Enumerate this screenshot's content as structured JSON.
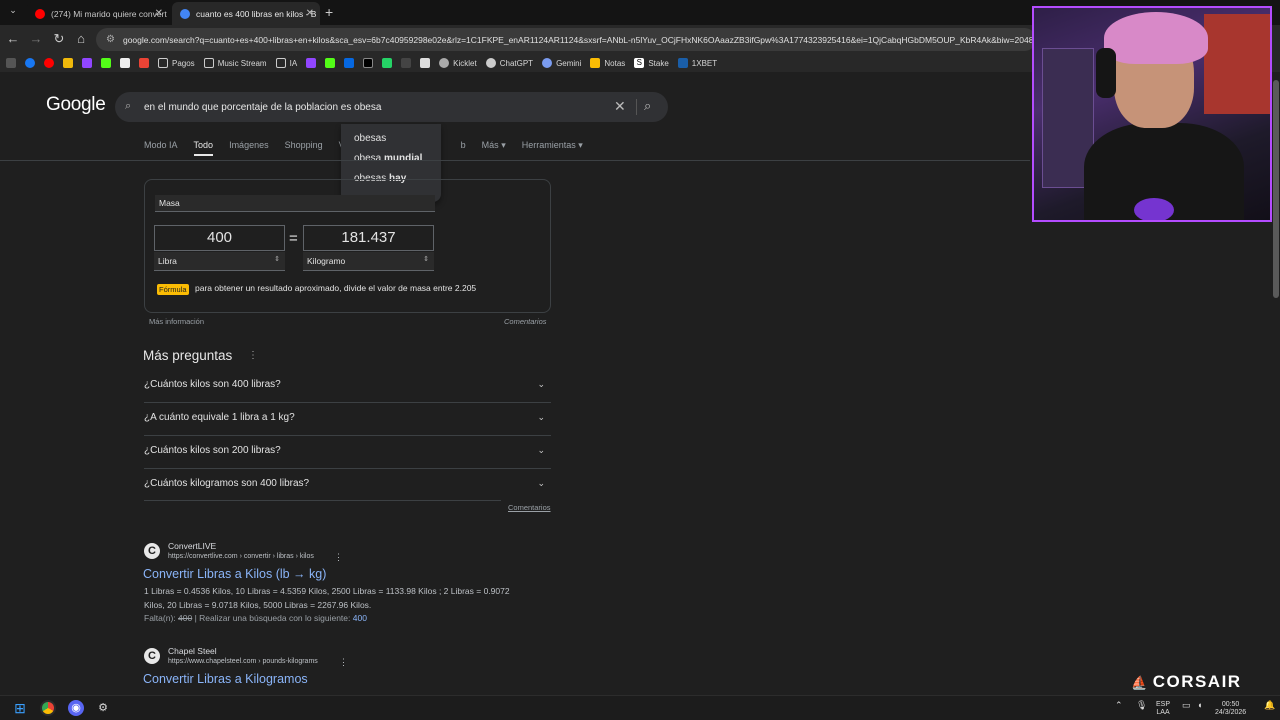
{
  "browser": {
    "tabs": [
      {
        "title": "(274) Mi marido quiere convert",
        "favicon_color": "#ff0000",
        "active": false
      },
      {
        "title": "cuanto es 400 libras en kilos - B",
        "favicon_color": "#4285f4",
        "active": true
      }
    ],
    "url": "google.com/search?q=cuanto+es+400+libras+en+kilos&sca_esv=6b7c40959298e02e&rlz=1C1FKPE_enAR1124AR1124&sxsrf=ANbL-n5lYuv_OCjFHxNK6OAaazZB3ifGpw%3A1774323925416&ei=1QjCabqHGbDM5OUP_KbR4Ak&biw=2048",
    "bookmarks": [
      {
        "label": "Pagos",
        "icon": "folder-icon"
      },
      {
        "label": "Music Stream",
        "icon": "folder-icon"
      },
      {
        "label": "IA",
        "icon": "folder-icon"
      },
      {
        "label": "Kicklet",
        "icon": "kicklet-icon"
      },
      {
        "label": "ChatGPT",
        "icon": "chatgpt-icon"
      },
      {
        "label": "Gemini",
        "icon": "gemini-icon"
      },
      {
        "label": "Notas",
        "icon": "notes-icon"
      },
      {
        "label": "Stake",
        "icon": "stake-icon"
      },
      {
        "label": "1XBET",
        "icon": "1xbet-icon"
      }
    ]
  },
  "google": {
    "logo": "Google",
    "query": "en el mundo que porcentaje de la poblacion es obesa",
    "suggestions": [
      {
        "prefix": "obesas",
        "bold": ""
      },
      {
        "prefix": "obesa ",
        "bold": "mundial"
      },
      {
        "prefix": "obesas ",
        "bold": "hay"
      }
    ],
    "tabs": [
      "Modo IA",
      "Todo",
      "Imágenes",
      "Shopping",
      "V",
      "b",
      "Más",
      "Herramientas"
    ],
    "active_tab": "Todo"
  },
  "converter": {
    "category": "Masa",
    "from_value": "400",
    "to_value": "181.437",
    "equals": "=",
    "from_unit": "Libra",
    "to_unit": "Kilogramo",
    "formula_badge": "Fórmula",
    "formula_text": "para obtener un resultado aproximado, divide el valor de masa entre 2.205",
    "more_info": "Más información",
    "feedback": "Comentarios"
  },
  "paa": {
    "title": "Más preguntas",
    "questions": [
      "¿Cuántos kilos son 400 libras?",
      "¿A cuánto equivale 1 libra a 1 kg?",
      "¿Cuántos kilos son 200 libras?",
      "¿Cuántos kilogramos son 400 libras?"
    ],
    "feedback": "Comentarios"
  },
  "results": [
    {
      "site": "ConvertLIVE",
      "url": "https://convertlive.com › convertir › libras › kilos",
      "title": "Convertir Libras a Kilos (lb → kg)",
      "snippet_line1": "1 Libras = 0.4536 Kilos, 10 Libras = 4.5359 Kilos, 2500 Libras = 1133.98 Kilos ; 2 Libras = 0.9072",
      "snippet_line2": "Kilos, 20 Libras = 9.0718 Kilos, 5000 Libras = 2267.96 Kilos.",
      "missing_label": "Falta(n):",
      "missing_term": "400",
      "missing_action": "| Realizar una búsqueda con lo siguiente:",
      "missing_link": "400"
    },
    {
      "site": "Chapel Steel",
      "url": "https://www.chapelsteel.com › pounds-kilograms",
      "title": "Convertir Libras a Kilogramos"
    }
  ],
  "overlay": {
    "brand": "CORSAIR"
  },
  "taskbar": {
    "lang_top": "ESP",
    "lang_bottom": "LAA",
    "time": "00:50",
    "date": "24/3/2026"
  },
  "colors": {
    "accent_purple": "#b44cff",
    "link_blue": "#8ab4f8",
    "formula_yellow": "#fbbc04"
  }
}
